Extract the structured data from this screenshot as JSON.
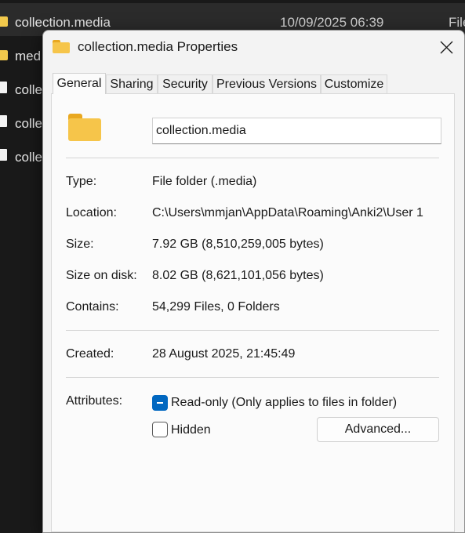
{
  "explorer": {
    "rows": [
      {
        "name": "collection.media",
        "date": "10/09/2025 06:39",
        "type": "File"
      },
      {
        "name": "med"
      },
      {
        "name": "colle"
      },
      {
        "name": "colle"
      },
      {
        "name": "colle"
      }
    ]
  },
  "dialog": {
    "title": "collection.media Properties",
    "tabs": [
      "General",
      "Sharing",
      "Security",
      "Previous Versions",
      "Customize"
    ],
    "active_tab": "General",
    "folder_name": "collection.media",
    "details": {
      "type_label": "Type:",
      "type_value": "File folder (.media)",
      "location_label": "Location:",
      "location_value": "C:\\Users\\mmjan\\AppData\\Roaming\\Anki2\\User 1",
      "size_label": "Size:",
      "size_value": "7.92 GB (8,510,259,005 bytes)",
      "size_on_disk_label": "Size on disk:",
      "size_on_disk_value": "8.02 GB (8,621,101,056 bytes)",
      "contains_label": "Contains:",
      "contains_value": "54,299 Files, 0 Folders",
      "created_label": "Created:",
      "created_value": "28 August 2025, 21:45:49"
    },
    "attributes": {
      "label": "Attributes:",
      "readonly_label": "Read-only (Only applies to files in folder)",
      "readonly_state": "indeterminate",
      "hidden_label": "Hidden",
      "hidden_state": "unchecked",
      "advanced_button": "Advanced..."
    }
  },
  "colors": {
    "background": "#191919",
    "dialog": "#f3f3f3",
    "accent": "#0067c0",
    "folder": "#f6c54a"
  }
}
